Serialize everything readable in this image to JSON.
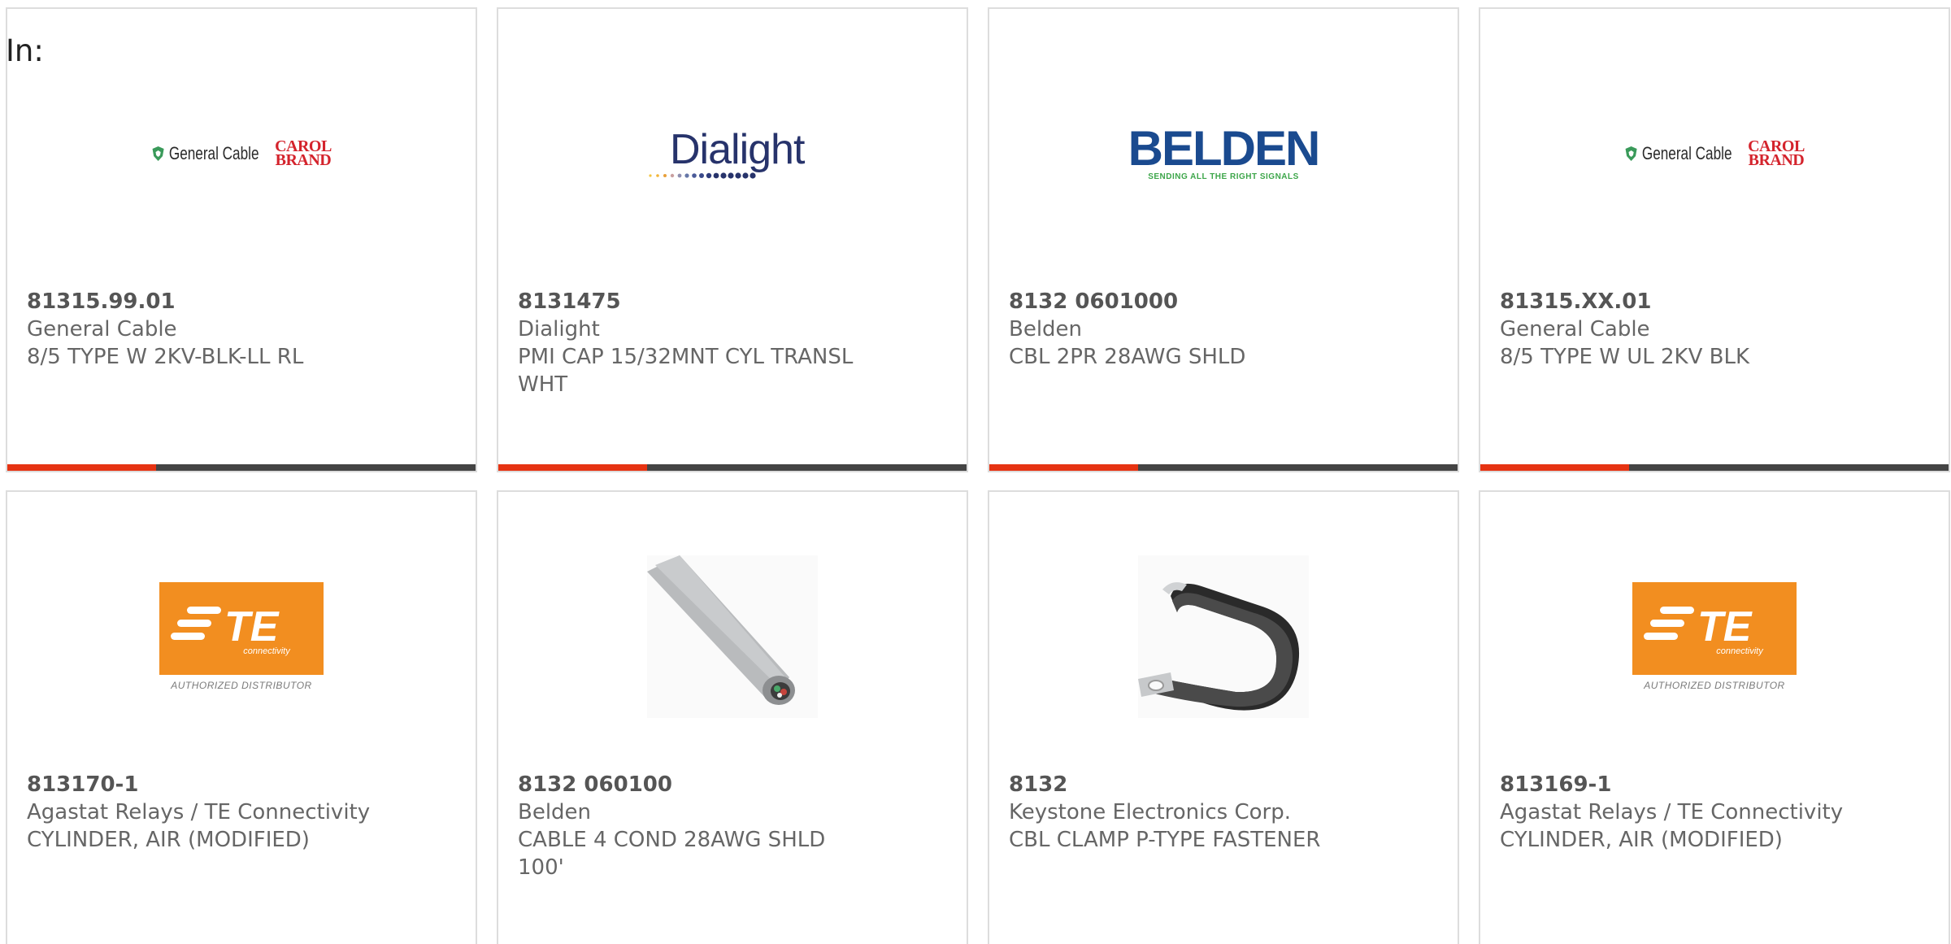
{
  "filter": {
    "in_label": "In:"
  },
  "colors": {
    "accent": "#e63312",
    "bar": "#444444",
    "te_orange": "#f28e20"
  },
  "products": [
    {
      "part_number": "81315.99.01",
      "manufacturer": "General Cable",
      "description": "8/5 TYPE W 2KV-BLK-LL RL",
      "image": "general-cable-logo",
      "logo": {
        "name": "General Cable",
        "brand": "CAROL BRAND"
      }
    },
    {
      "part_number": "8131475",
      "manufacturer": "Dialight",
      "description": "PMI CAP 15/32MNT CYL TRANSL WHT",
      "image": "dialight-logo",
      "logo": {
        "name": "Dialight"
      }
    },
    {
      "part_number": "8132 0601000",
      "manufacturer": "Belden",
      "description": "CBL 2PR 28AWG SHLD",
      "image": "belden-logo",
      "logo": {
        "name": "BELDEN",
        "tagline": "SENDING ALL THE RIGHT SIGNALS"
      }
    },
    {
      "part_number": "81315.XX.01",
      "manufacturer": "General Cable",
      "description": "8/5 TYPE W UL 2KV BLK",
      "image": "general-cable-logo",
      "logo": {
        "name": "General Cable",
        "brand": "CAROL BRAND"
      }
    },
    {
      "part_number": "813170-1",
      "manufacturer": "Agastat Relays / TE Connectivity",
      "description": "CYLINDER, AIR (MODIFIED)",
      "image": "te-connectivity-logo",
      "logo": {
        "name": "TE",
        "sub": "connectivity",
        "caption": "AUTHORIZED DISTRIBUTOR"
      }
    },
    {
      "part_number": "8132 060100",
      "manufacturer": "Belden",
      "description": "CABLE 4 COND 28AWG SHLD 100'",
      "image": "gray-cable-photo"
    },
    {
      "part_number": "8132",
      "manufacturer": "Keystone Electronics Corp.",
      "description": "CBL CLAMP P-TYPE FASTENER",
      "image": "p-clamp-photo"
    },
    {
      "part_number": "813169-1",
      "manufacturer": "Agastat Relays / TE Connectivity",
      "description": "CYLINDER, AIR (MODIFIED)",
      "image": "te-connectivity-logo",
      "logo": {
        "name": "TE",
        "sub": "connectivity",
        "caption": "AUTHORIZED DISTRIBUTOR"
      }
    }
  ]
}
